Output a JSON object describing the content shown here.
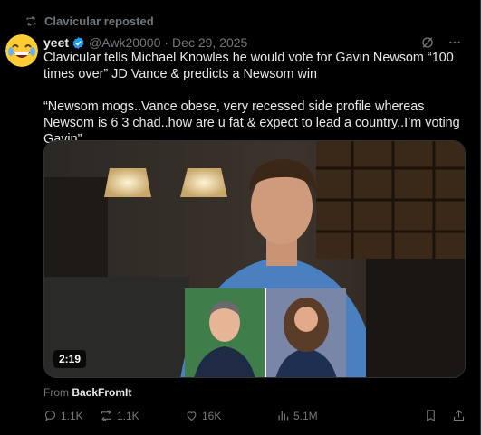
{
  "repost": {
    "label": "Clavicular reposted"
  },
  "post": {
    "name": "yeet",
    "handle": "@Awk20000",
    "separator": "·",
    "date": "Dec 29, 2025",
    "text": "Clavicular tells Michael Knowles he would vote for Gavin Newsom “100 times over” JD Vance & predicts a Newsom win\n\n“Newsom mogs..Vance obese, very recessed side profile whereas Newsom is 6 3 chad..how are u fat & expect to lead a country..I’m voting Gavin”"
  },
  "media": {
    "duration": "2:19"
  },
  "source": {
    "prefix": "From",
    "name": "BackFromIt"
  },
  "actions": {
    "replies": "1.1K",
    "reposts": "1.1K",
    "likes": "16K",
    "views": "5.1M"
  },
  "colors": {
    "verified": "#1d9bf0",
    "muted": "#71767b",
    "text": "#e7e9ea",
    "background": "#000000"
  },
  "icons": [
    "retweet-icon",
    "verified-badge-icon",
    "grok-icon",
    "more-icon",
    "reply-icon",
    "repost-icon",
    "like-icon",
    "views-icon",
    "bookmark-icon",
    "share-icon"
  ]
}
